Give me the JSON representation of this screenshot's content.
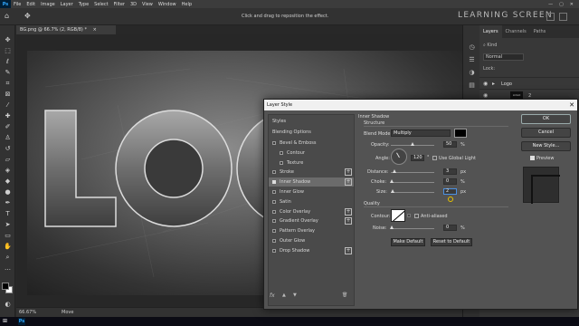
{
  "menubar": {
    "logo": "Ps",
    "items": [
      "File",
      "Edit",
      "Image",
      "Layer",
      "Type",
      "Select",
      "Filter",
      "3D",
      "View",
      "Window",
      "Help"
    ],
    "win_min": "—",
    "win_max": "▢",
    "win_close": "✕"
  },
  "optionsbar": {
    "hint": "Click and drag to reposition the effect.",
    "brand": "LEARNING SCREEN"
  },
  "document": {
    "tab_title": "BG.png @ 66.7% (2, RGB/8) *",
    "tab_close": "×",
    "zoom": "66.67%",
    "mode": "Move"
  },
  "layers_panel": {
    "tabs": [
      "Layers",
      "Channels",
      "Paths"
    ],
    "kind_label": "Kind",
    "blend": "Normal",
    "lock_label": "Lock:",
    "group_name": "Logo",
    "layer_thumb_text": "LOGO",
    "layer_name": "2"
  },
  "dialog": {
    "title": "Layer Style",
    "close": "✕",
    "styles_header": "Styles",
    "blending_options": "Blending Options",
    "styles": [
      {
        "label": "Bevel & Emboss",
        "checked": false,
        "plus": false,
        "indent": false
      },
      {
        "label": "Contour",
        "checked": false,
        "plus": false,
        "indent": true
      },
      {
        "label": "Texture",
        "checked": false,
        "plus": false,
        "indent": true
      },
      {
        "label": "Stroke",
        "checked": false,
        "plus": true,
        "indent": false
      },
      {
        "label": "Inner Shadow",
        "checked": true,
        "plus": true,
        "indent": false
      },
      {
        "label": "Inner Glow",
        "checked": false,
        "plus": false,
        "indent": false
      },
      {
        "label": "Satin",
        "checked": false,
        "plus": false,
        "indent": false
      },
      {
        "label": "Color Overlay",
        "checked": false,
        "plus": true,
        "indent": false
      },
      {
        "label": "Gradient Overlay",
        "checked": false,
        "plus": true,
        "indent": false
      },
      {
        "label": "Pattern Overlay",
        "checked": false,
        "plus": false,
        "indent": false
      },
      {
        "label": "Outer Glow",
        "checked": false,
        "plus": false,
        "indent": false
      },
      {
        "label": "Drop Shadow",
        "checked": false,
        "plus": true,
        "indent": false
      }
    ],
    "footer": {
      "fx": "fx",
      "up": "▲",
      "down": "▼",
      "trash": "🗑"
    },
    "inner_shadow": {
      "heading": "Inner Shadow",
      "structure": "Structure",
      "blend_mode_label": "Blend Mode:",
      "blend_mode": "Multiply",
      "shadow_color": "#000000",
      "opacity_label": "Opacity:",
      "opacity": "50",
      "angle_label": "Angle:",
      "angle": "120",
      "degree": "°",
      "use_global_light": "Use Global Light",
      "distance_label": "Distance:",
      "distance": "3",
      "choke_label": "Choke:",
      "choke": "0",
      "size_label": "Size:",
      "size": "2",
      "quality": "Quality",
      "contour_label": "Contour:",
      "anti_aliased": "Anti-aliased",
      "noise_label": "Noise:",
      "noise": "0",
      "pct": "%",
      "px": "px",
      "make_default": "Make Default",
      "reset_default": "Reset to Default"
    },
    "buttons": {
      "ok": "OK",
      "cancel": "Cancel",
      "new_style": "New Style...",
      "preview": "Preview"
    }
  },
  "canvas": {
    "logo_text": "LOGO"
  },
  "taskbar": {
    "start": "⊞",
    "ps": "Ps"
  }
}
